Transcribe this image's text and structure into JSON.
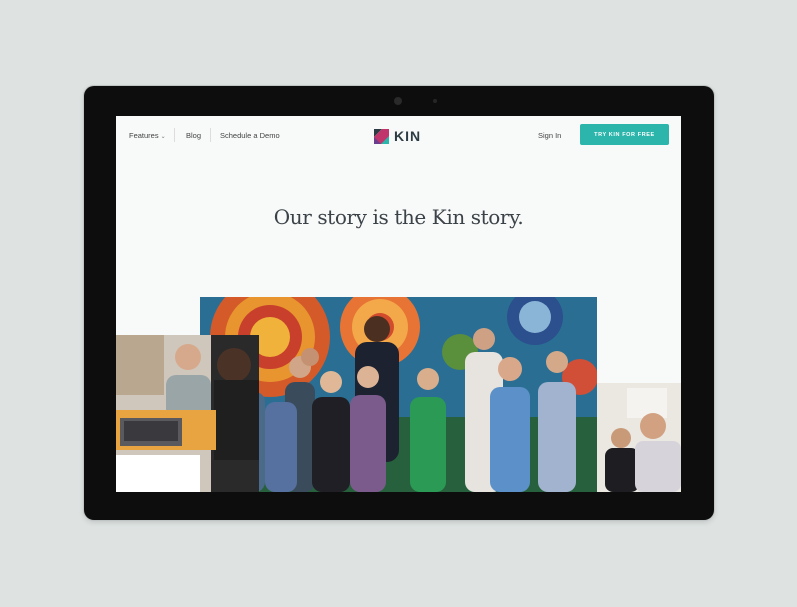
{
  "nav": {
    "features_label": "Features",
    "blog_label": "Blog",
    "demo_label": "Schedule a Demo",
    "signin_label": "Sign In",
    "cta_label": "TRY KIN FOR FREE"
  },
  "logo": {
    "text": "KIN"
  },
  "hero": {
    "headline": "Our story is the Kin story."
  },
  "colors": {
    "accent": "#2bb5ab",
    "logo_dark": "#2d3c44",
    "logo_magenta": "#c0356b",
    "logo_teal": "#2bb5ab"
  },
  "icons": {
    "features_dropdown": "chevron-down-icon"
  }
}
